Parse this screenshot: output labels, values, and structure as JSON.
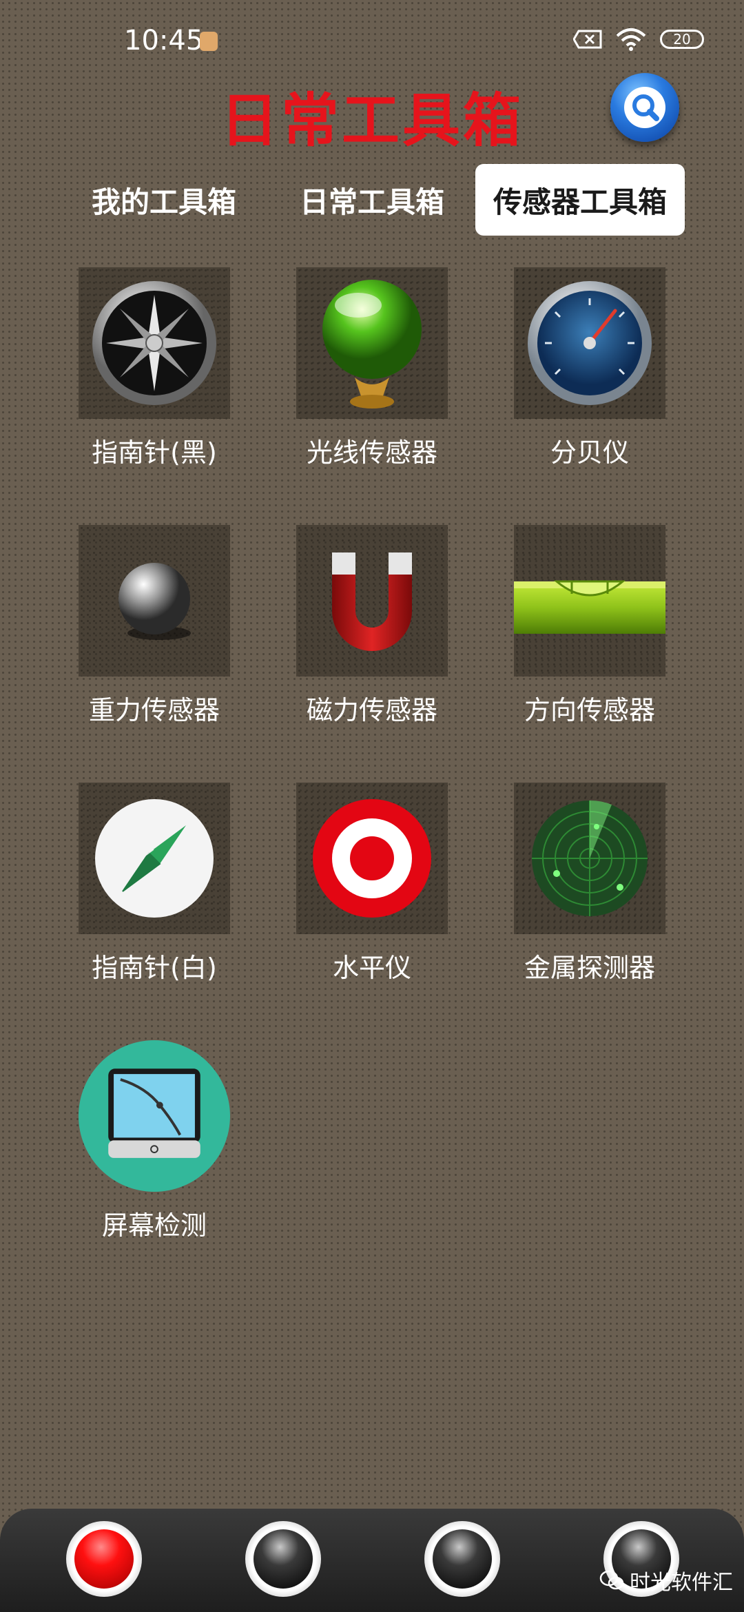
{
  "status": {
    "time": "10:45",
    "battery": "20"
  },
  "header": {
    "title": "日常工具箱"
  },
  "tabs": [
    {
      "label": "我的工具箱",
      "active": false
    },
    {
      "label": "日常工具箱",
      "active": false
    },
    {
      "label": "传感器工具箱",
      "active": true
    }
  ],
  "tools": [
    {
      "label": "指南针(黑)",
      "icon": "compass-black-icon"
    },
    {
      "label": "光线传感器",
      "icon": "green-orb-icon"
    },
    {
      "label": "分贝仪",
      "icon": "gauge-icon"
    },
    {
      "label": "重力传感器",
      "icon": "steel-ball-icon"
    },
    {
      "label": "磁力传感器",
      "icon": "magnet-icon"
    },
    {
      "label": "方向传感器",
      "icon": "spirit-level-icon"
    },
    {
      "label": "指南针(白)",
      "icon": "compass-white-icon"
    },
    {
      "label": "水平仪",
      "icon": "target-icon"
    },
    {
      "label": "金属探测器",
      "icon": "radar-icon"
    },
    {
      "label": "屏幕检测",
      "icon": "screen-test-icon"
    }
  ],
  "watermark": "时光软件汇",
  "colors": {
    "title": "#e6141c",
    "background": "#6a5f51",
    "activeTabBg": "#ffffff"
  }
}
